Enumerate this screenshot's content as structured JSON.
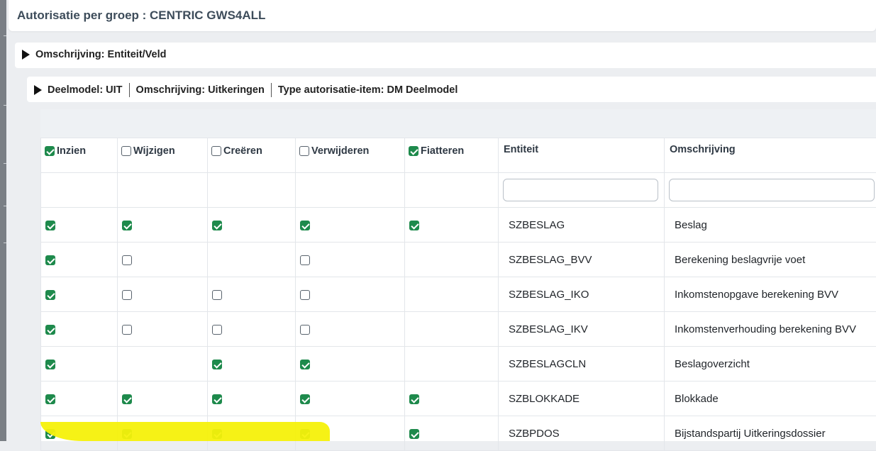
{
  "page": {
    "title": "Autorisatie per groep : CENTRIC GWS4ALL"
  },
  "level1": {
    "label": "Omschrijving: Entiteit/Veld",
    "expanded": false
  },
  "level2": {
    "expanded": false,
    "segments": [
      "Deelmodel: UIT",
      "Omschrijving: Uitkeringen",
      "Type autorisatie-item: DM Deelmodel"
    ]
  },
  "columns": [
    {
      "key": "inzien",
      "label": "Inzien",
      "checked": true
    },
    {
      "key": "wijzigen",
      "label": "Wijzigen",
      "checked": false
    },
    {
      "key": "creeren",
      "label": "Creëren",
      "checked": false
    },
    {
      "key": "verwijderen",
      "label": "Verwijderen",
      "checked": false
    },
    {
      "key": "fiatteren",
      "label": "Fiatteren",
      "checked": true
    },
    {
      "key": "entiteit",
      "label": "Entiteit"
    },
    {
      "key": "omschrijving",
      "label": "Omschrijving"
    }
  ],
  "filters": {
    "entiteit": "",
    "omschrijving": ""
  },
  "rows": [
    {
      "entiteit": "SZBESLAG",
      "omschrijving": "Beslag",
      "inzien": "on",
      "wijzigen": "on",
      "creeren": "on",
      "verwijderen": "on",
      "fiatteren": "on"
    },
    {
      "entiteit": "SZBESLAG_BVV",
      "omschrijving": "Berekening beslagvrije voet",
      "inzien": "on",
      "wijzigen": "off",
      "creeren": "none",
      "verwijderen": "off",
      "fiatteren": "none"
    },
    {
      "entiteit": "SZBESLAG_IKO",
      "omschrijving": "Inkomstenopgave berekening BVV",
      "inzien": "on",
      "wijzigen": "off",
      "creeren": "off",
      "verwijderen": "off",
      "fiatteren": "none"
    },
    {
      "entiteit": "SZBESLAG_IKV",
      "omschrijving": "Inkomstenverhouding berekening BVV",
      "inzien": "on",
      "wijzigen": "off",
      "creeren": "off",
      "verwijderen": "off",
      "fiatteren": "none"
    },
    {
      "entiteit": "SZBESLAGCLN",
      "omschrijving": "Beslagoverzicht",
      "inzien": "on",
      "wijzigen": "none",
      "creeren": "on",
      "verwijderen": "on",
      "fiatteren": "none"
    },
    {
      "entiteit": "SZBLOKKADE",
      "omschrijving": "Blokkade",
      "inzien": "on",
      "wijzigen": "on",
      "creeren": "on",
      "verwijderen": "on",
      "fiatteren": "on"
    },
    {
      "entiteit": "SZBPDOS",
      "omschrijving": "Bijstandspartij Uitkeringsdossier",
      "inzien": "on",
      "wijzigen": "on",
      "creeren": "on",
      "verwijderen": "on",
      "fiatteren": "on",
      "highlighted": true
    }
  ],
  "colors": {
    "checked": "#1e8a4c",
    "highlight": "#f6f10a"
  }
}
